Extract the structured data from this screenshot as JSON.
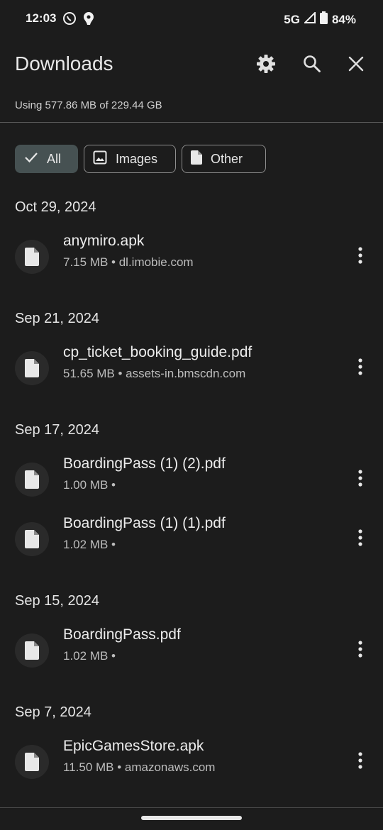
{
  "status_bar": {
    "time": "12:03",
    "network": "5G",
    "battery": "84%"
  },
  "header": {
    "title": "Downloads",
    "settings_icon": "gear-icon",
    "search_icon": "search-icon",
    "close_icon": "close-icon"
  },
  "storage": {
    "text": "Using 577.86 MB of 229.44 GB"
  },
  "filters": [
    {
      "label": "All",
      "icon": "check-icon",
      "selected": true
    },
    {
      "label": "Images",
      "icon": "image-icon",
      "selected": false
    },
    {
      "label": "Other",
      "icon": "file-icon",
      "selected": false
    }
  ],
  "groups": [
    {
      "date": "Oct 29, 2024",
      "items": [
        {
          "name": "anymiro.apk",
          "meta": "7.15 MB • dl.imobie.com"
        }
      ]
    },
    {
      "date": "Sep 21, 2024",
      "items": [
        {
          "name": "cp_ticket_booking_guide.pdf",
          "meta": "51.65 MB • assets-in.bmscdn.com"
        }
      ]
    },
    {
      "date": "Sep 17, 2024",
      "items": [
        {
          "name": "BoardingPass (1) (2).pdf",
          "meta": "1.00 MB •"
        },
        {
          "name": "BoardingPass (1) (1).pdf",
          "meta": "1.02 MB •"
        }
      ]
    },
    {
      "date": "Sep 15, 2024",
      "items": [
        {
          "name": "BoardingPass.pdf",
          "meta": "1.02 MB •"
        }
      ]
    },
    {
      "date": "Sep 7, 2024",
      "items": [
        {
          "name": "EpicGamesStore.apk",
          "meta": "11.50 MB • amazonaws.com"
        }
      ]
    }
  ],
  "colors": {
    "background": "#1c1c1c",
    "chip_selected": "#465152",
    "text": "#e6e6e6",
    "secondary_text": "#bdbdbd"
  }
}
